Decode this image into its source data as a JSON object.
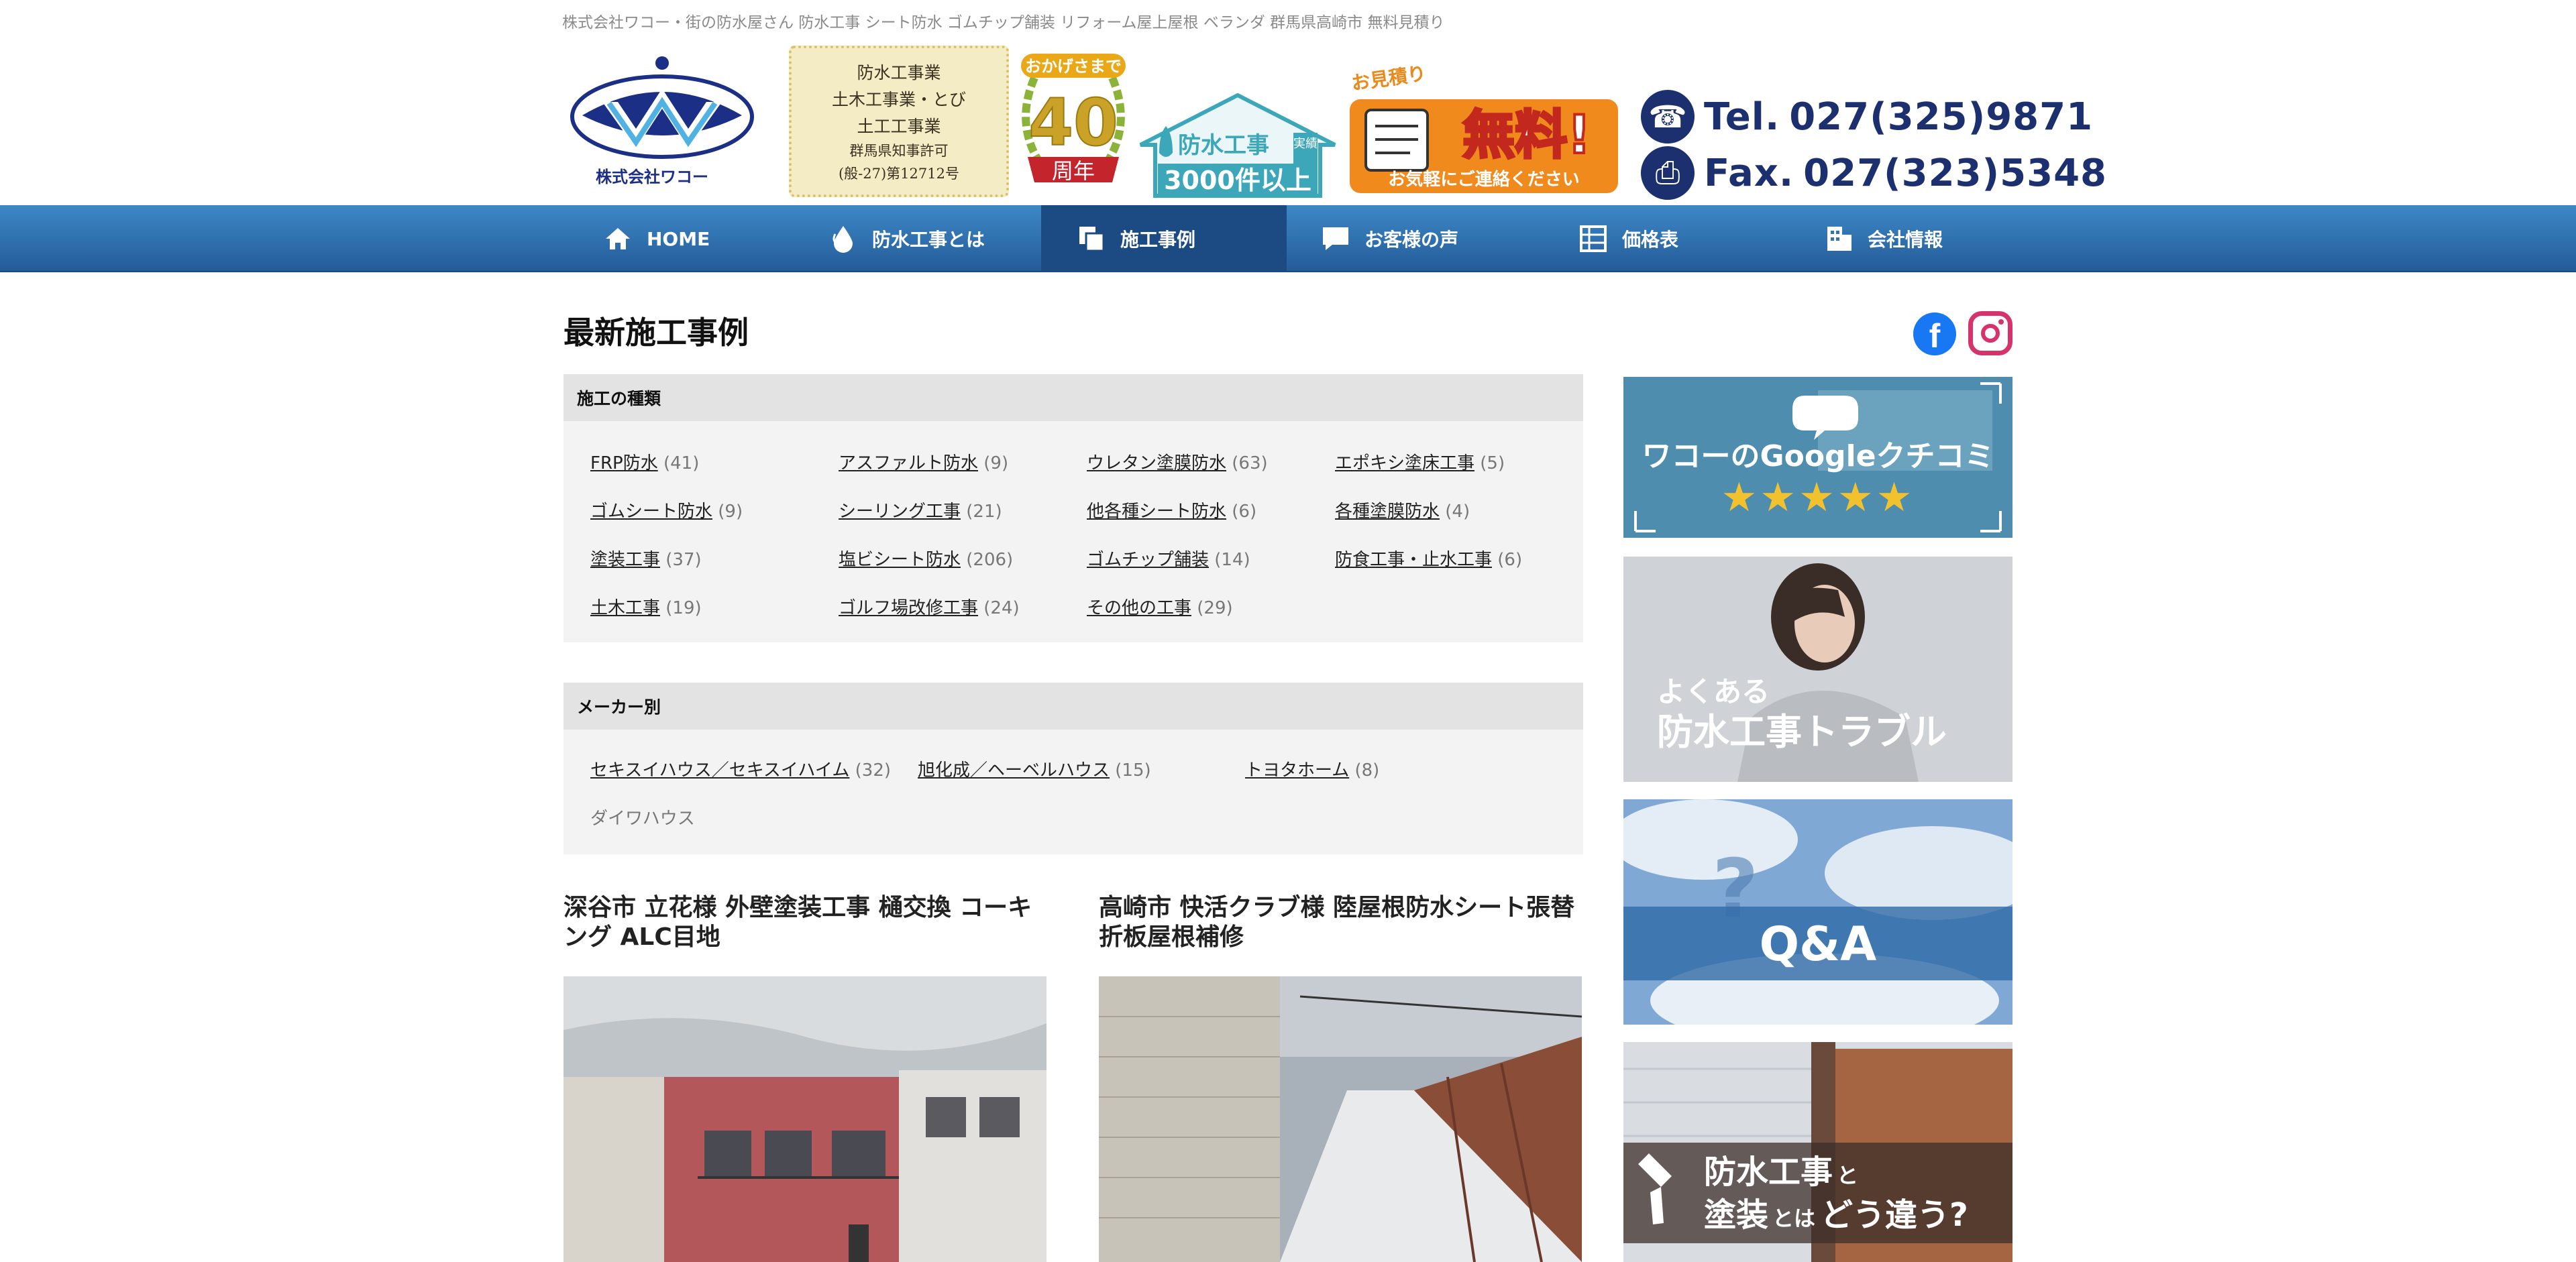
{
  "header": {
    "tagline": "株式会社ワコー・街の防水屋さん 防水工事 シート防水 ゴムチップ舗装 リフォーム屋上屋根 ベランダ 群馬県高崎市 無料見積り",
    "company_name": "株式会社ワコー",
    "license_lines": [
      "防水工事業",
      "土木工事業・とび",
      "土工工事業",
      "群馬県知事許可",
      "(般-27)第12712号"
    ],
    "anniversary_top": "おかげさまで",
    "anniversary_number": "40",
    "anniversary_label": "周年",
    "count_title": "防水工事",
    "count_badge": "実績",
    "count_value": "3000件以上",
    "estimate_top": "お見積り",
    "estimate_main": "無料!",
    "estimate_sub": "お気軽にご連絡ください",
    "tel_label": "Tel.",
    "tel": "027(325)9871",
    "fax_label": "Fax.",
    "fax": "027(323)5348"
  },
  "nav": [
    {
      "label": "HOME",
      "icon": "home-icon"
    },
    {
      "label": "防水工事とは",
      "icon": "water-drop-icon"
    },
    {
      "label": "施工事例",
      "icon": "copy-icon"
    },
    {
      "label": "お客様の声",
      "icon": "speech-bubble-icon"
    },
    {
      "label": "価格表",
      "icon": "table-icon"
    },
    {
      "label": "会社情報",
      "icon": "building-icon"
    }
  ],
  "main": {
    "page_title": "最新施工事例",
    "types_heading": "施工の種類",
    "types": [
      {
        "label": "FRP防水",
        "count": "(41)"
      },
      {
        "label": "アスファルト防水",
        "count": "(9)"
      },
      {
        "label": "ウレタン塗膜防水",
        "count": "(63)"
      },
      {
        "label": "エポキシ塗床工事",
        "count": "(5)"
      },
      {
        "label": "ゴムシート防水",
        "count": "(9)"
      },
      {
        "label": "シーリング工事",
        "count": "(21)"
      },
      {
        "label": "他各種シート防水",
        "count": "(6)"
      },
      {
        "label": "各種塗膜防水",
        "count": "(4)"
      },
      {
        "label": "塗装工事",
        "count": "(37)"
      },
      {
        "label": "塩ビシート防水",
        "count": "(206)"
      },
      {
        "label": "ゴムチップ舗装",
        "count": "(14)"
      },
      {
        "label": "防食工事・止水工事",
        "count": "(6)"
      },
      {
        "label": "土木工事",
        "count": "(19)"
      },
      {
        "label": "ゴルフ場改修工事",
        "count": "(24)"
      },
      {
        "label": "その他の工事",
        "count": "(29)"
      }
    ],
    "maker_heading": "メーカー別",
    "makers": [
      {
        "label": "セキスイハウス／セキスイハイム",
        "count": "(32)"
      },
      {
        "label": "旭化成／ヘーベルハウス",
        "count": "(15)"
      },
      {
        "label": "トヨタホーム",
        "count": "(8)"
      }
    ],
    "maker_plain": "ダイワハウス",
    "articles": [
      {
        "title": "深谷市 立花様 外壁塗装工事 樋交換 コーキング ALC目地"
      },
      {
        "title": "高崎市 快活クラブ様 陸屋根防水シート張替 折板屋根補修"
      }
    ]
  },
  "sidebar": {
    "google_title": "ワコーのGoogleクチコミ",
    "stars": "★★★★★",
    "trouble_line1": "よくある",
    "trouble_line2": "防水工事トラブル",
    "qa": "Q&A",
    "diff_line1a": "防水工事",
    "diff_line1b": "と",
    "diff_line2a": "塗装",
    "diff_line2b": "とは",
    "diff_line2c": "どう違う?"
  },
  "social": {
    "facebook": "f"
  },
  "colors": {
    "nav": "#2f73b4",
    "nav_active": "#1b4b82",
    "brand": "#1c2f86",
    "estimate": "#f08a1c"
  }
}
